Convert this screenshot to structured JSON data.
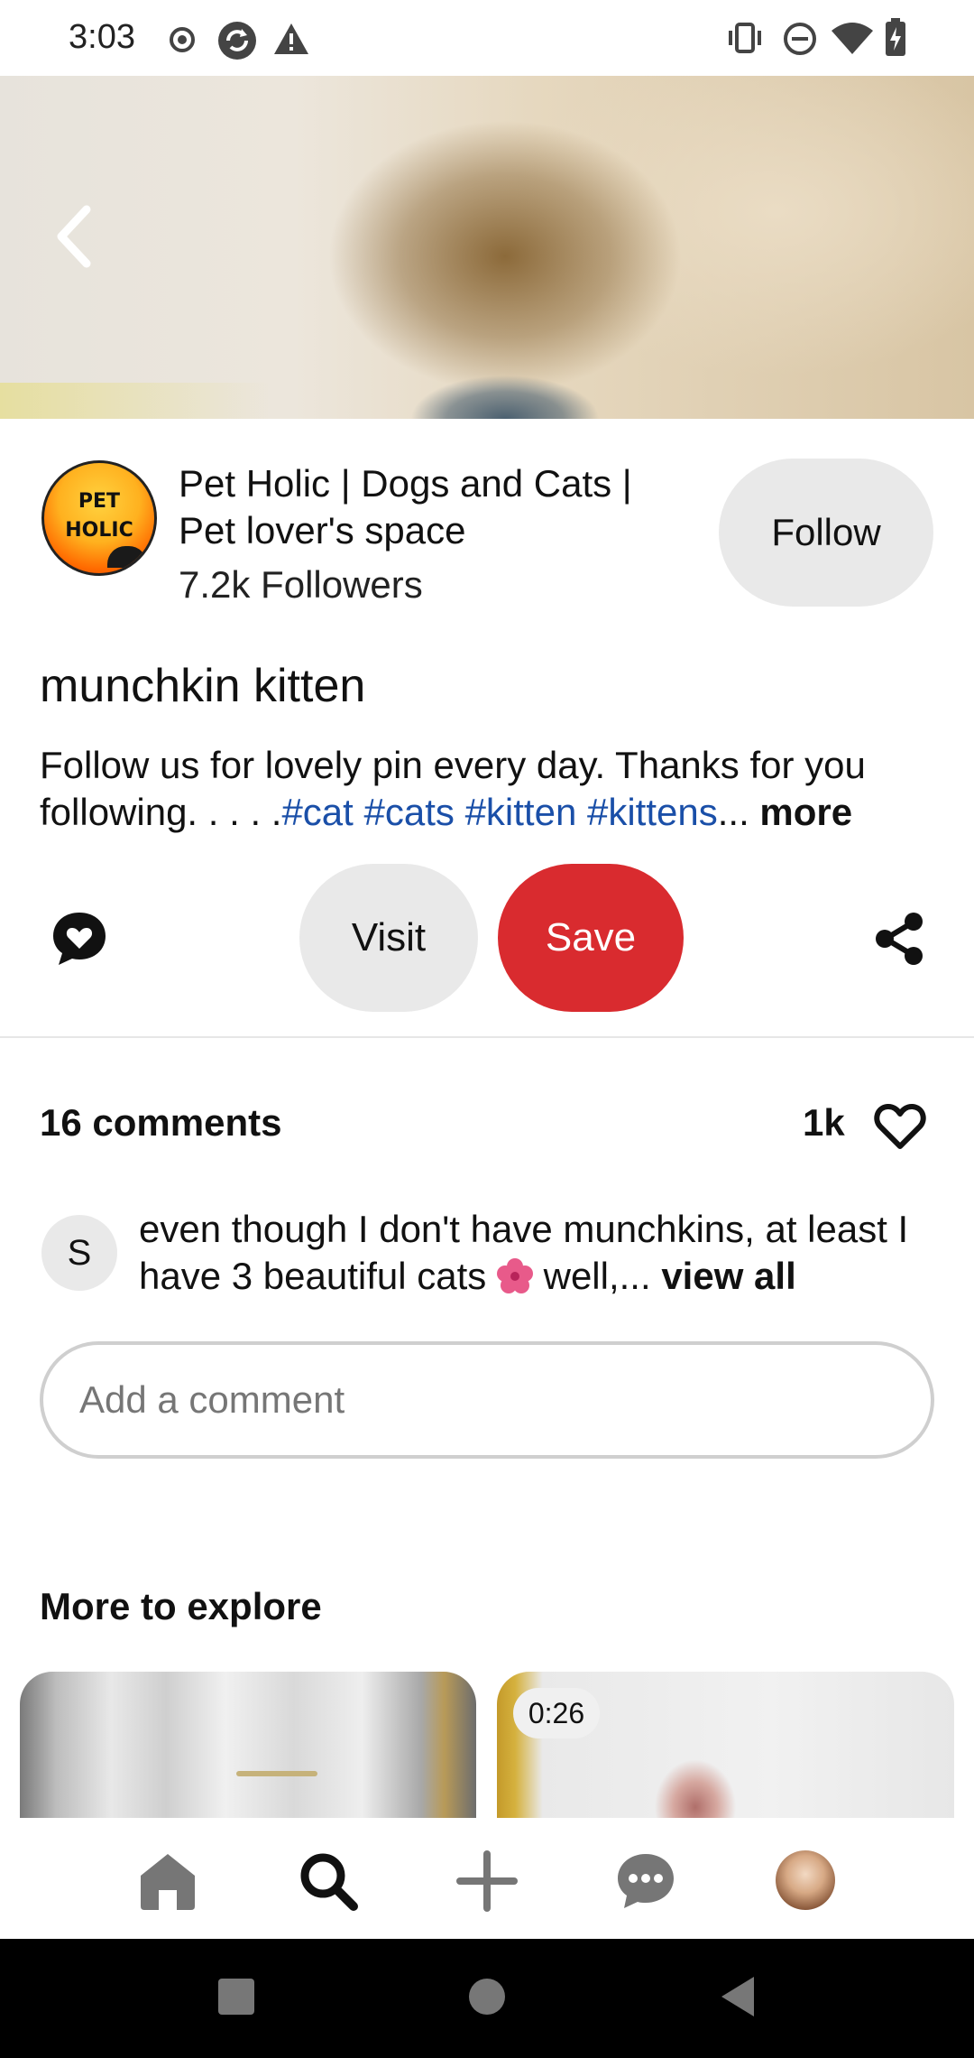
{
  "status_bar": {
    "time": "3:03",
    "left_icons": [
      "record-icon",
      "sync-icon",
      "warning-icon"
    ],
    "right_icons": [
      "vibrate-icon",
      "dnd-icon",
      "wifi-icon",
      "battery-charging-icon"
    ]
  },
  "pin": {
    "creator": {
      "logo_text_line1": "PET",
      "logo_text_line2": "HOLIC",
      "name": "Pet Holic | Dogs and Cats | Pet lover's space",
      "followers": "7.2k Followers",
      "follow_label": "Follow"
    },
    "title": "munchkin kitten",
    "description_text": "Follow us for lovely pin every day. Thanks for you following. . . . .",
    "description_tags": "#cat #cats #kitten #kittens",
    "description_ellipsis": "...",
    "description_more": " more"
  },
  "actions": {
    "visit_label": "Visit",
    "save_label": "Save",
    "accent_color": "#d92b2f"
  },
  "comments": {
    "count_label": "16 comments",
    "likes": "1k",
    "top_comment": {
      "avatar_initial": "S",
      "text_before_emoji": "even though I don't have munchkins, at least I have 3 beautiful cats ",
      "text_after_emoji": " well,... ",
      "view_all": "view all"
    },
    "input_placeholder": "Add a comment"
  },
  "explore": {
    "title": "More to explore",
    "tiles": [
      {
        "name": "explore-tile-1"
      },
      {
        "name": "explore-tile-2",
        "duration": "0:26"
      }
    ]
  },
  "bottom_nav": [
    "home-icon",
    "search-icon",
    "plus-icon",
    "messages-icon",
    "profile-avatar"
  ],
  "system_nav": [
    "recents-button",
    "home-button",
    "back-button"
  ]
}
